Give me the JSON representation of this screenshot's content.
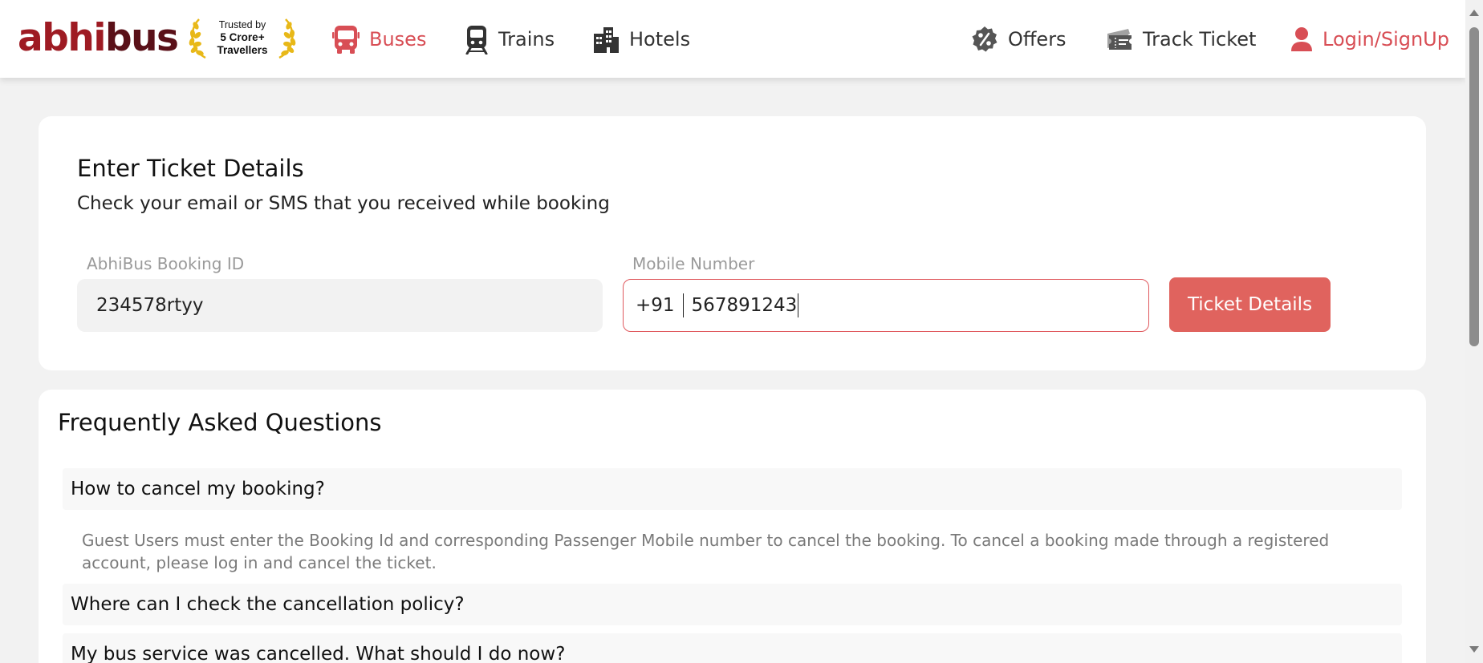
{
  "header": {
    "logo_part1": "abhi",
    "logo_part2": "bus",
    "trusted_line1": "Trusted by",
    "trusted_line2": "5 Crore+",
    "trusted_line3": "Travellers",
    "nav": {
      "buses": "Buses",
      "trains": "Trains",
      "hotels": "Hotels",
      "offers": "Offers",
      "track_ticket": "Track Ticket",
      "login": "Login/SignUp"
    },
    "active_tab": "Buses"
  },
  "ticket_form": {
    "title": "Enter Ticket Details",
    "subtitle": "Check your email or SMS that you received while booking",
    "booking_label": "AbhiBus Booking ID",
    "booking_value": "234578rtyy",
    "mobile_label": "Mobile Number",
    "mobile_prefix": "+91",
    "mobile_value": "567891243",
    "submit_label": "Ticket Details"
  },
  "faq": {
    "title": "Frequently Asked Questions",
    "items": [
      {
        "question": "How to cancel my booking?",
        "answer": "Guest Users must enter the Booking Id and corresponding Passenger Mobile number to cancel the booking. To cancel a booking made through a registered account, please log in and cancel the ticket."
      },
      {
        "question": "Where can I check the cancellation policy?"
      },
      {
        "question": "My bus service was cancelled. What should I do now?"
      }
    ]
  },
  "colors": {
    "brand_red": "#d84e55",
    "logo_red": "#9e1b23",
    "button_red": "#e0635e",
    "laurel_gold": "#e8b818"
  },
  "icons": [
    "bus-icon",
    "train-icon",
    "hotel-icon",
    "offers-badge-icon",
    "ticket-icon",
    "user-icon",
    "laurel-icon"
  ]
}
